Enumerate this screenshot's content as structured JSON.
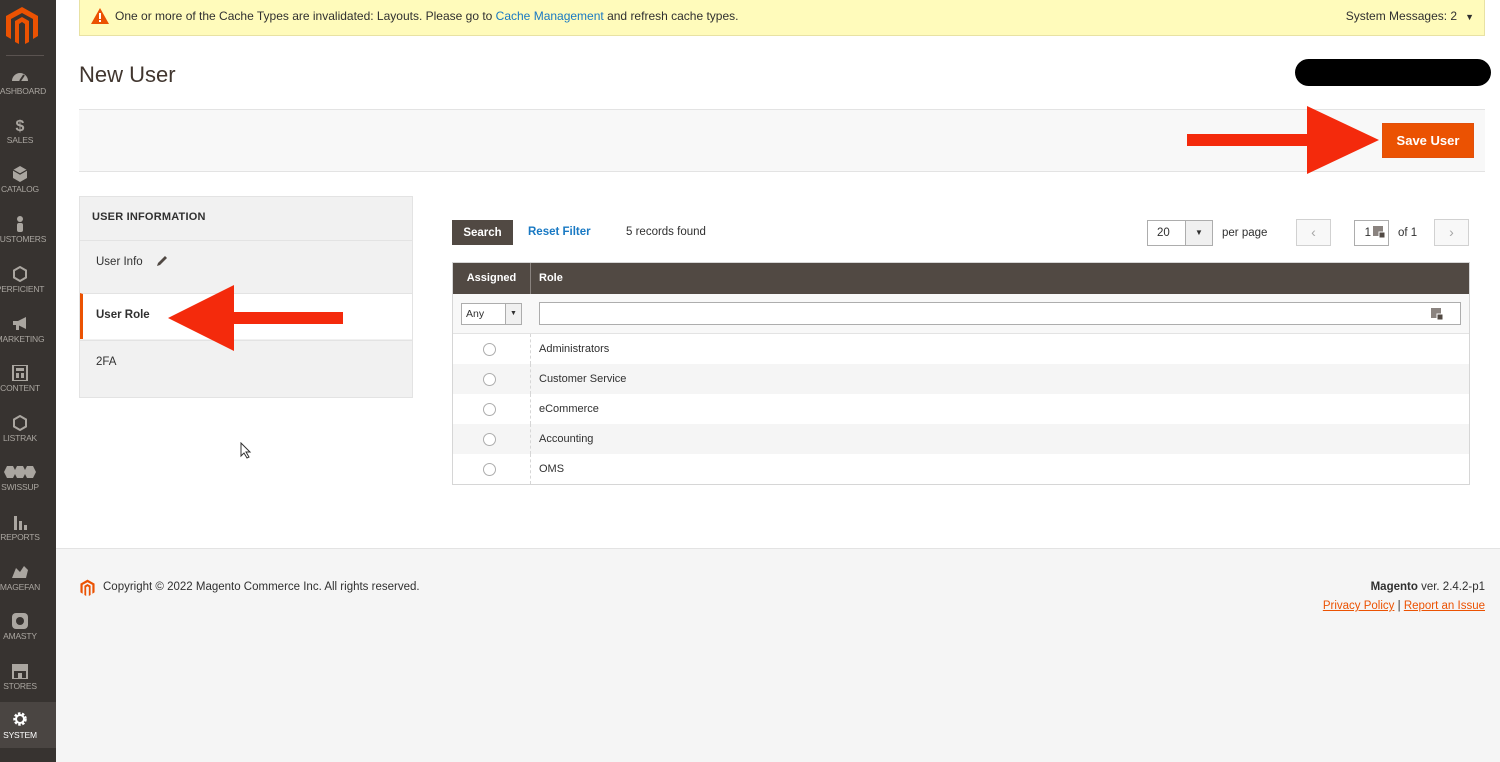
{
  "sidebar": {
    "items": [
      {
        "label": "Dashboard",
        "icon": "dashboard-icon"
      },
      {
        "label": "Sales",
        "icon": "dollar-icon"
      },
      {
        "label": "Catalog",
        "icon": "cube-icon"
      },
      {
        "label": "Customers",
        "icon": "person-icon"
      },
      {
        "label": "Perficient",
        "icon": "hexagon-icon"
      },
      {
        "label": "Marketing",
        "icon": "megaphone-icon"
      },
      {
        "label": "Content",
        "icon": "layout-icon"
      },
      {
        "label": "Listrak",
        "icon": "hexagon-icon"
      },
      {
        "label": "Swissup",
        "icon": "swissup-icon"
      },
      {
        "label": "Reports",
        "icon": "bar-chart-icon"
      },
      {
        "label": "Magefan",
        "icon": "magefan-icon"
      },
      {
        "label": "Amasty",
        "icon": "amasty-icon"
      },
      {
        "label": "Stores",
        "icon": "store-icon"
      },
      {
        "label": "System",
        "icon": "gear-icon"
      }
    ]
  },
  "message": {
    "text_before": "One or more of the Cache Types are invalidated: Layouts. Please go to ",
    "link": "Cache Management",
    "text_after": " and refresh cache types.",
    "system_messages": "System Messages: 2"
  },
  "page_title": "New User",
  "actions": {
    "save_label": "Save User"
  },
  "tabs": {
    "title": "USER INFORMATION",
    "items": [
      {
        "label": "User Info"
      },
      {
        "label": "User Role"
      },
      {
        "label": "2FA"
      }
    ]
  },
  "grid": {
    "search_label": "Search",
    "reset_label": "Reset Filter",
    "records": "5 records found",
    "per_page_value": "20",
    "per_page_label": "per page",
    "page_value": "1",
    "page_of": "of 1",
    "columns": [
      "Assigned",
      "Role"
    ],
    "assigned_filter": "Any",
    "rows": [
      "Administrators",
      "Customer Service",
      "eCommerce",
      "Accounting",
      "OMS"
    ]
  },
  "footer": {
    "copyright": "Copyright © 2022 Magento Commerce Inc. All rights reserved.",
    "brand": "Magento",
    "version": " ver. 2.4.2-p1",
    "privacy": "Privacy Policy",
    "separator": "|",
    "report": "Report an Issue"
  },
  "colors": {
    "accent": "#eb5202",
    "sidebar": "#373330",
    "grid_header": "#514943",
    "link": "#1979c3",
    "annotation_arrow": "#f42a0c"
  }
}
